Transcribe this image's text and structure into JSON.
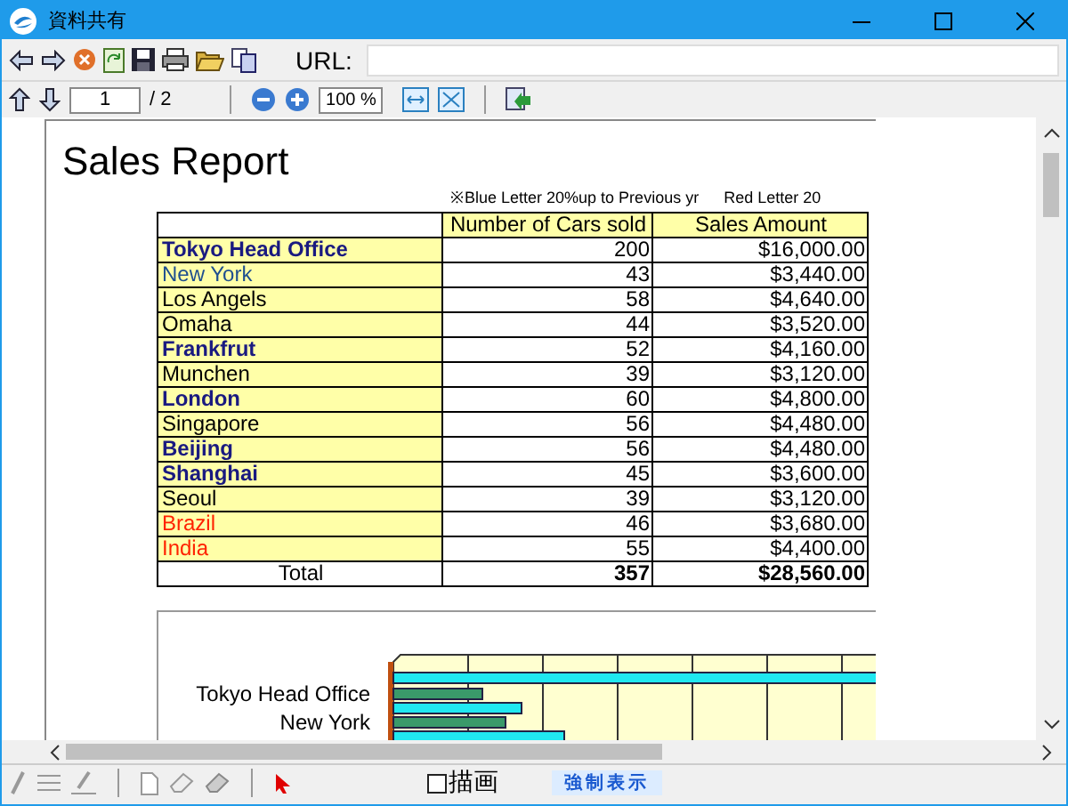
{
  "window": {
    "title": "資料共有"
  },
  "toolbar": {
    "url_label": "URL:"
  },
  "navigation": {
    "page": "1",
    "page_count": "/ 2",
    "zoom": "100 %"
  },
  "document": {
    "title": "Sales Report",
    "note_blue": "※Blue Letter 20%up to Previous yr",
    "note_red": "Red Letter 20",
    "columns": [
      "Number of Cars sold",
      "Sales Amount"
    ],
    "rows": [
      {
        "name": "Tokyo Head Office",
        "cars": "200",
        "amount": "$16,000.00",
        "color": "#1a1a80",
        "bold": true
      },
      {
        "name": "New York",
        "cars": "43",
        "amount": "$3,440.00",
        "color": "#1f4f8f",
        "bold": false
      },
      {
        "name": "Los Angels",
        "cars": "58",
        "amount": "$4,640.00",
        "color": "#000000",
        "bold": false
      },
      {
        "name": "Omaha",
        "cars": "44",
        "amount": "$3,520.00",
        "color": "#000000",
        "bold": false
      },
      {
        "name": "Frankfrut",
        "cars": "52",
        "amount": "$4,160.00",
        "color": "#1a1a80",
        "bold": true
      },
      {
        "name": "Munchen",
        "cars": "39",
        "amount": "$3,120.00",
        "color": "#000000",
        "bold": false
      },
      {
        "name": "London",
        "cars": "60",
        "amount": "$4,800.00",
        "color": "#1a1a80",
        "bold": true
      },
      {
        "name": "Singapore",
        "cars": "56",
        "amount": "$4,480.00",
        "color": "#000000",
        "bold": false
      },
      {
        "name": "Beijing",
        "cars": "56",
        "amount": "$4,480.00",
        "color": "#1a1a80",
        "bold": true
      },
      {
        "name": "Shanghai",
        "cars": "45",
        "amount": "$3,600.00",
        "color": "#1a1a80",
        "bold": true
      },
      {
        "name": "Seoul",
        "cars": "39",
        "amount": "$3,120.00",
        "color": "#000000",
        "bold": false
      },
      {
        "name": "Brazil",
        "cars": "46",
        "amount": "$3,680.00",
        "color": "#ff2200",
        "bold": false
      },
      {
        "name": "India",
        "cars": "55",
        "amount": "$4,400.00",
        "color": "#ff2200",
        "bold": false
      }
    ],
    "total": {
      "label": "Total",
      "cars": "357",
      "amount": "$28,560.00"
    },
    "chart": {
      "labels": [
        "Tokyo Head Office",
        "New York"
      ]
    }
  },
  "bottom_bar": {
    "checkbox": {
      "label": "描画",
      "checked": false
    },
    "button": "強制表示"
  }
}
